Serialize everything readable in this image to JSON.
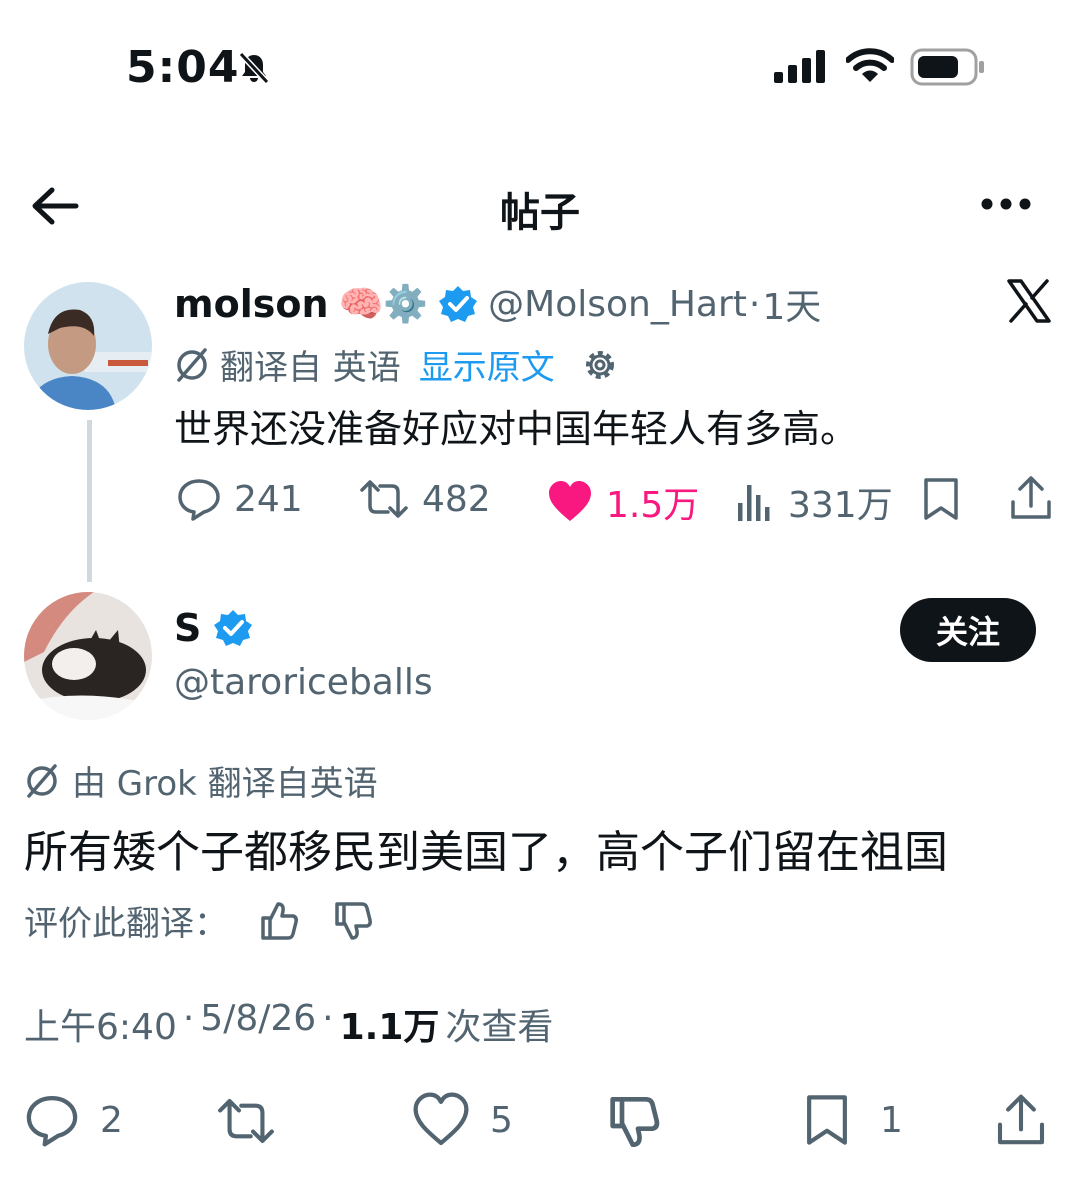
{
  "status_bar": {
    "time": "5:04"
  },
  "header": {
    "title": "帖子"
  },
  "original_tweet": {
    "display_name": "molson",
    "name_emojis": "🧠⚙️",
    "handle": "@Molson_Hart",
    "separator": "·",
    "age": "1天",
    "translated_from": "翻译自 英语",
    "show_original": "显示原文",
    "text": "世界还没准备好应对中国年轻人有多高。",
    "stats": {
      "replies": "241",
      "retweets": "482",
      "likes": "1.5万",
      "views": "331万"
    },
    "colors": {
      "like": "#f91880"
    }
  },
  "reply": {
    "display_name": "S",
    "handle": "@taroriceballs",
    "follow_label": "关注",
    "translation_note": "由 Grok 翻译自英语",
    "text": "所有矮个子都移民到美国了，高个子们留在祖国",
    "rate_translation": "评价此翻译：",
    "meta": {
      "time": "上午6:40",
      "date": "5/8/26",
      "views_count": "1.1万",
      "views_label": "次查看",
      "separator": "·"
    },
    "stats": {
      "replies": "2",
      "likes": "5",
      "bookmarks": "1"
    }
  },
  "colors": {
    "accent": "#1d9bf0",
    "text": "#0f1419",
    "secondary": "#536471"
  }
}
